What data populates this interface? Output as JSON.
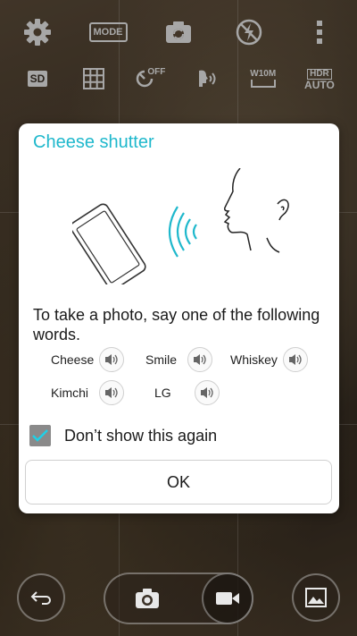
{
  "toolbar": {
    "mode_label": "MODE",
    "storage_label": "SD",
    "timer_label": "OFF",
    "resolution_label": "W10M",
    "hdr_label_top": "HDR",
    "hdr_label_bottom": "AUTO"
  },
  "dialog": {
    "title": "Cheese shutter",
    "message": "To take a photo, say one of the following words.",
    "words": [
      "Cheese",
      "Smile",
      "Whiskey",
      "Kimchi",
      "LG"
    ],
    "checkbox_label": "Don’t show this again",
    "checkbox_checked": true,
    "ok_label": "OK"
  },
  "colors": {
    "accent": "#1fb8cc",
    "checkbox_bg": "#8a8a8a"
  },
  "icons": {
    "top_row": [
      "gear-icon",
      "mode-icon",
      "switch-camera-icon",
      "flash-off-icon",
      "more-vert-icon"
    ],
    "second_row": [
      "sd-storage-icon",
      "grid-icon",
      "timer-off-icon",
      "voice-shutter-icon",
      "resolution-icon",
      "hdr-auto-icon"
    ],
    "bottom": [
      "back-icon",
      "camera-icon",
      "video-icon",
      "gallery-icon"
    ]
  }
}
